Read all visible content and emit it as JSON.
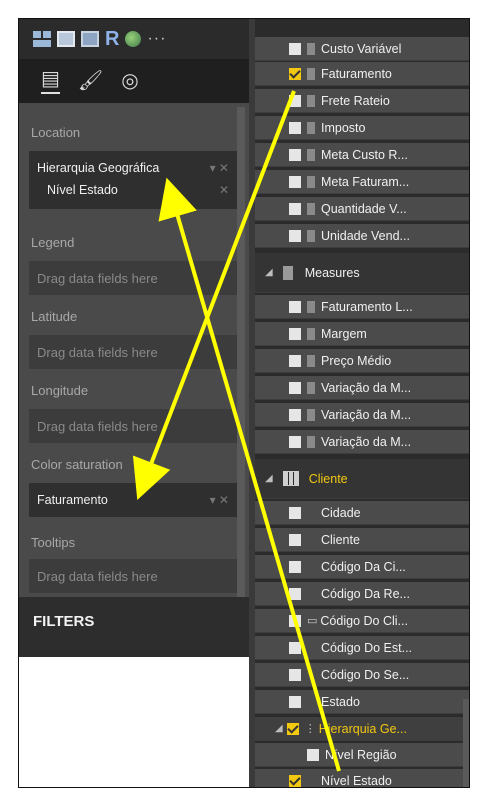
{
  "colors": {
    "accent": "#f2c811",
    "arrow": "#ffff00"
  },
  "toolbar": {
    "visuals": [
      "map-visual-icon",
      "table-visual-icon",
      "matrix-visual-icon",
      "r-visual-icon",
      "globe-visual-icon",
      "more-icon"
    ],
    "r_label": "R",
    "more_label": "···",
    "tabs": [
      "fields-tab-icon",
      "format-tab-icon",
      "analytics-tab-icon"
    ]
  },
  "wells": {
    "location": {
      "label": "Location",
      "fields": [
        "Hierarquia Geográfica",
        "Nível Estado"
      ]
    },
    "legend": {
      "label": "Legend",
      "placeholder": "Drag data fields here"
    },
    "latitude": {
      "label": "Latitude",
      "placeholder": "Drag data fields here"
    },
    "longitude": {
      "label": "Longitude",
      "placeholder": "Drag data fields here"
    },
    "color_saturation": {
      "label": "Color saturation",
      "field": "Faturamento"
    },
    "tooltips": {
      "label": "Tooltips",
      "placeholder": "Drag data fields here"
    }
  },
  "filters_label": "FILTERS",
  "fields": {
    "top_items": [
      {
        "label": "Custo Variável",
        "checked": false
      },
      {
        "label": "Faturamento",
        "checked": true
      },
      {
        "label": "Frete Rateio",
        "checked": false
      },
      {
        "label": "Imposto",
        "checked": false
      },
      {
        "label": "Meta Custo R...",
        "checked": false
      },
      {
        "label": "Meta Faturam...",
        "checked": false
      },
      {
        "label": "Quantidade V...",
        "checked": false
      },
      {
        "label": "Unidade Vend...",
        "checked": false
      }
    ],
    "measures_label": "Measures",
    "measure_items": [
      "Faturamento L...",
      "Margem",
      "Preço Médio",
      "Variação da M...",
      "Variação da M...",
      "Variação da M..."
    ],
    "cliente_label": "Cliente",
    "cliente_items": [
      "Cidade",
      "Cliente",
      "Código Da Ci...",
      "Código Da Re...",
      "Código Do Cli...",
      "Código Do Est...",
      "Código Do Se...",
      "Estado"
    ],
    "hierarchy_label": "Hierarquia Ge...",
    "hierarchy_items": [
      {
        "label": "Nível Região",
        "checked": false
      },
      {
        "label": "Nível Estado",
        "checked": true
      }
    ]
  }
}
